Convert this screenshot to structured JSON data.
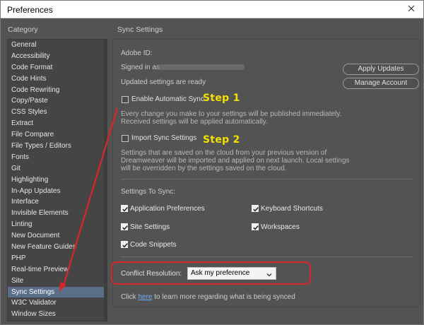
{
  "window": {
    "title": "Preferences"
  },
  "left_panel": {
    "header": "Category",
    "items": [
      "General",
      "Accessibility",
      "Code Format",
      "Code Hints",
      "Code Rewriting",
      "Copy/Paste",
      "CSS Styles",
      "Extract",
      "File Compare",
      "File Types / Editors",
      "Fonts",
      "Git",
      "Highlighting",
      "In-App Updates",
      "Interface",
      "Invisible Elements",
      "Linting",
      "New Document",
      "New Feature Guides",
      "PHP",
      "Real-time Preview",
      "Site",
      "Sync Settings",
      "W3C Validator",
      "Window Sizes"
    ],
    "selected": "Sync Settings"
  },
  "sync": {
    "header": "Sync Settings",
    "adobe_id_label": "Adobe ID:",
    "signed_in_label": "Signed in as",
    "updated_text": "Updated settings are ready",
    "apply_updates": "Apply Updates",
    "manage_account": "Manage Account",
    "enable_auto_sync": "Enable Automatic Sync",
    "auto_sync_desc_1": "Every change you make to your settings will be published immediately.",
    "auto_sync_desc_2": "Received settings will be applied automatically.",
    "import_sync": "Import Sync Settings",
    "import_desc_1": "Settings that are saved on the cloud from your previous version of",
    "import_desc_2": "Dreamweaver will be imported and applied on next launch. Local settings",
    "import_desc_3": "will be overridden by the settings saved on the cloud.",
    "settings_to_sync": "Settings To Sync:",
    "options": {
      "app_prefs": "Application Preferences",
      "keyboard": "Keyboard Shortcuts",
      "site_settings": "Site Settings",
      "workspaces": "Workspaces",
      "snippets": "Code Snippets"
    },
    "conflict_label": "Conflict Resolution:",
    "conflict_value": "Ask my preference",
    "footer_prefix": "Click",
    "footer_link": "here",
    "footer_suffix": "to learn more regarding what is being synced"
  },
  "annotations": {
    "step1": "Step 1",
    "step2": "Step 2"
  },
  "colors": {
    "accent_red": "#d8262a",
    "step_yellow": "#f5e000",
    "selected_bg": "#5a6e8a"
  },
  "icons": {
    "close": "close-icon",
    "dropdown": "chevron-down-icon",
    "check": "check-icon"
  }
}
